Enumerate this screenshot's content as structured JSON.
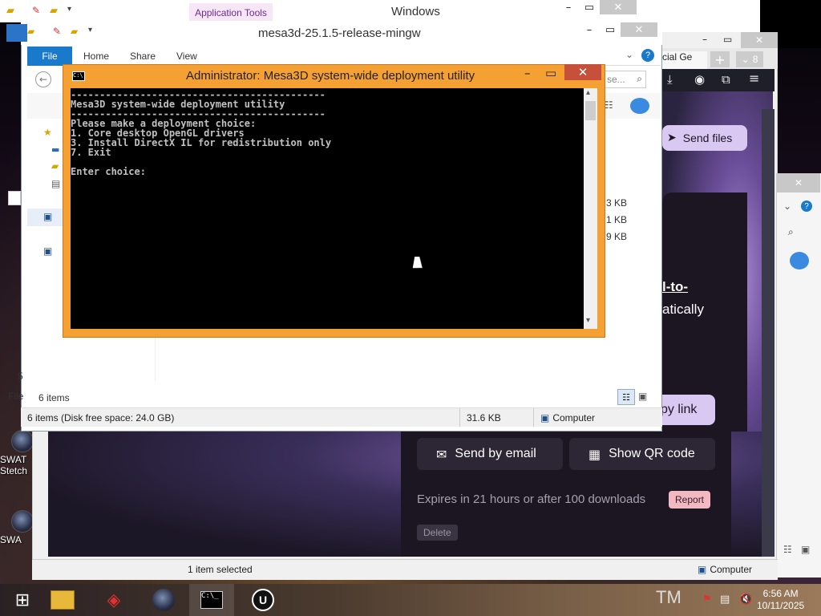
{
  "back_window": {
    "context_tab": "Application Tools",
    "title": "Windows"
  },
  "explorer": {
    "title": "mesa3d-25.1.5-release-mingw",
    "ribbon_tabs": [
      "File",
      "Home",
      "Share",
      "View"
    ],
    "file_sizes": [
      "3 KB",
      "1 KB",
      "9 KB"
    ],
    "item_count": "6 items",
    "status": {
      "items": "6 items (Disk free space: 24.0 GB)",
      "size": "31.6 KB",
      "location": "Computer"
    }
  },
  "cmd": {
    "title": "Administrator:  Mesa3D system-wide deployment utility",
    "lines": [
      "--------------------------------------------",
      "Mesa3D system-wide deployment utility",
      "--------------------------------------------",
      "Please make a deployment choice:",
      "1. Core desktop OpenGL drivers",
      "3. Install DirectX IL for redistribution only",
      "7. Exit",
      "",
      "Enter choice:"
    ]
  },
  "browser": {
    "tab_partial": "cial Ge",
    "tab_count": "8",
    "search_partial": "se...",
    "send_files": "Send files",
    "link_partial_1": "l-to-",
    "link_partial_2": "atically",
    "copy_link_partial": "py link",
    "send_by_email": "Send by email",
    "show_qr_code": "Show QR code",
    "expires": "Expires in 21 hours or after 100 downloads",
    "report": "Report",
    "delete": "Delete"
  },
  "bottom_status": {
    "selected": "1 item selected",
    "location": "Computer"
  },
  "desktop_icons": [
    {
      "label_line1": "SWAT",
      "label_line2": "Stetch"
    },
    {
      "label_line1": "SWA",
      "label_line2": ""
    }
  ],
  "left_partial": {
    "char_5": "5",
    "file_label": "File"
  },
  "taskbar": {
    "time": "6:56 AM",
    "date": "10/11/2025",
    "tm_mark": "TM"
  },
  "colors": {
    "cmd_frame": "#f5a033",
    "file_tab": "#1979ca",
    "wetransfer_panel": "#1c1622",
    "report_button": "#f3b9c2"
  }
}
